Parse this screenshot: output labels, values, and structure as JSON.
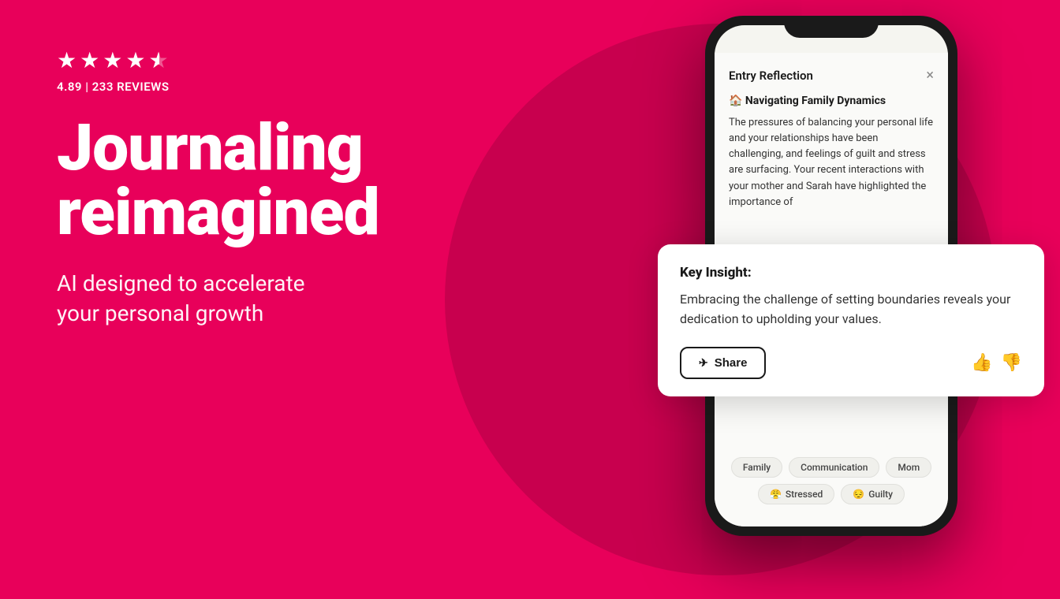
{
  "background": {
    "primary_color": "#E8005A",
    "circle_color": "#C8004E"
  },
  "left": {
    "stars": {
      "count": 4.5,
      "filled": 4,
      "half": 1,
      "display": "★ ★ ★ ★ ½"
    },
    "rating": "4.89",
    "separator": "|",
    "reviews": "233 REVIEWS",
    "heading_line1": "Journaling",
    "heading_line2": "reimagined",
    "subheading_line1": "AI designed to accelerate",
    "subheading_line2": "your personal growth"
  },
  "phone": {
    "entry_reflection_title": "Entry Reflection",
    "close_icon": "×",
    "entry_emoji": "🏠",
    "entry_subtitle": "Navigating Family Dynamics",
    "entry_body": "The pressures of balancing your personal life and your relationships have been challenging, and feelings of guilt and stress are surfacing. Your recent interactions with your mother and Sarah have highlighted the importance of",
    "tags": [
      "Family",
      "Communication",
      "Mom"
    ],
    "emotion_tags": [
      {
        "emoji": "😤",
        "label": "Stressed"
      },
      {
        "emoji": "😔",
        "label": "Guilty"
      }
    ]
  },
  "insight_card": {
    "label": "Key Insight:",
    "text": "Embracing the challenge of setting boundaries reveals your dedication to upholding your values.",
    "share_btn": "Share",
    "share_icon": "▶",
    "thumbs_up": "👍",
    "thumbs_down": "👎"
  }
}
